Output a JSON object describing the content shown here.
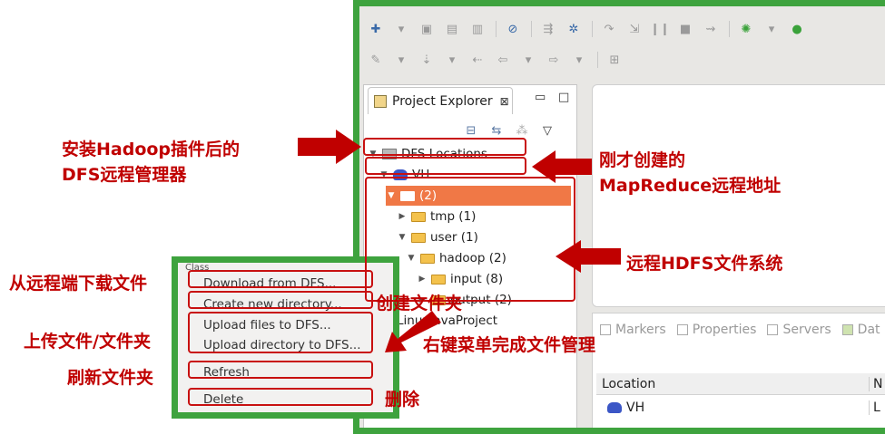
{
  "project_explorer": {
    "tab_label": "Project Explorer",
    "tab_close": "⊠",
    "minimize": "▭",
    "maximize": "□"
  },
  "tree": {
    "dfs_locations": "DFS Locations",
    "vh": "VH",
    "root": "(2)",
    "tmp": "tmp (1)",
    "user": "user (1)",
    "hadoop": "hadoop (2)",
    "input": "input (8)",
    "output": "output (2)",
    "linux_project": "LinuxJavaProject"
  },
  "bottom_panel": {
    "tabs": [
      "Markers",
      "Properties",
      "Servers",
      "Dat"
    ],
    "col_location": "Location",
    "col_m": "N",
    "row_location": "VH",
    "row_u": "L"
  },
  "context_menu": {
    "clipped_text": "Class",
    "items": [
      "Download from DFS...",
      "Create new directory...",
      "Upload files to DFS...",
      "Upload directory to DFS...",
      "Refresh",
      "Delete"
    ]
  },
  "annotations": {
    "dfs_manager_line1": "安装Hadoop插件后的",
    "dfs_manager_line2": "DFS远程管理器",
    "mapreduce_line1": "刚才创建的",
    "mapreduce_line2": "MapReduce远程地址",
    "hdfs": "远程HDFS文件系统",
    "download": "从远程端下载文件",
    "create_dir": "创建文件夹",
    "upload": "上传文件/文件夹",
    "right_click": "右键菜单完成文件管理",
    "refresh": "刷新文件夹",
    "delete": "删除"
  },
  "colors": {
    "annotation_red": "#c00000",
    "frame_green": "#3ea33e",
    "selection_orange": "#f07846"
  }
}
